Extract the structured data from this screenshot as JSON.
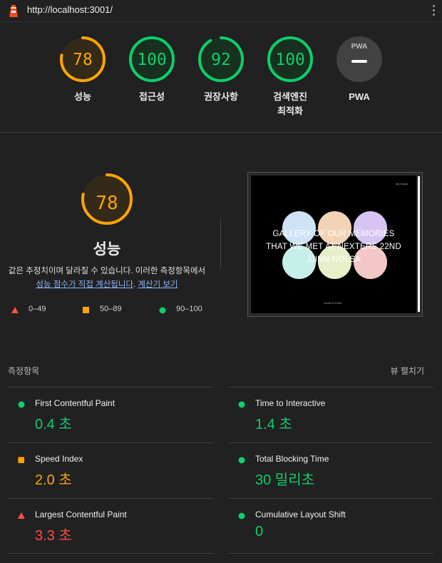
{
  "browser": {
    "url": "http://localhost:3001/"
  },
  "colors": {
    "pass": "#0cce6b",
    "average": "#ffa400",
    "fail": "#ff4e42",
    "neutral": "#9e9e9e"
  },
  "summary": {
    "gauges": [
      {
        "score": "78",
        "label": "성능",
        "status": "average"
      },
      {
        "score": "100",
        "label": "접근성",
        "status": "pass"
      },
      {
        "score": "92",
        "label": "권장사항",
        "status": "pass"
      },
      {
        "score": "100",
        "label_line1": "검색엔진",
        "label_line2": "최적화",
        "status": "pass"
      },
      {
        "badge": "PWA",
        "label": "PWA",
        "status": "neutral"
      }
    ]
  },
  "performance": {
    "score": "78",
    "title": "성능",
    "desc": "값은 추정치이며 달라질 수 있습니다. 이러한 측정항목에서",
    "link1": "성능 점수가 직접 계산됩니다",
    "link_sep": ". ",
    "link2": "계산기 보기",
    "legend": [
      {
        "range": "0–49",
        "status": "fail"
      },
      {
        "range": "50–89",
        "status": "average"
      },
      {
        "range": "90–100",
        "status": "pass"
      }
    ],
    "screenshot": {
      "headline_1": "GALLERY OF OUR MEMORIES",
      "headline_2": "THAT WE MET AT NEXTERS 22ND",
      "headline_3": "JJINN-NOLSA",
      "corner_text": "Jjin Nolsa",
      "footer_text": "Scroll to Enter",
      "circle_colors": [
        "#cfe3f7",
        "#f3d3b6",
        "#d6c4f2",
        "#c7efe9",
        "#e6f0c8",
        "#f4c7c7"
      ]
    }
  },
  "metrics": {
    "heading": "측정항목",
    "expand_label": "뷰 펼치기",
    "items": [
      {
        "name": "First Contentful Paint",
        "value": "0.4 초",
        "status": "pass"
      },
      {
        "name": "Time to Interactive",
        "value": "1.4 초",
        "status": "pass"
      },
      {
        "name": "Speed Index",
        "value": "2.0 초",
        "status": "average"
      },
      {
        "name": "Total Blocking Time",
        "value": "30 밀리초",
        "status": "pass"
      },
      {
        "name": "Largest Contentful Paint",
        "value": "3.3 초",
        "status": "fail"
      },
      {
        "name": "Cumulative Layout Shift",
        "value": "0",
        "status": "pass"
      }
    ]
  }
}
